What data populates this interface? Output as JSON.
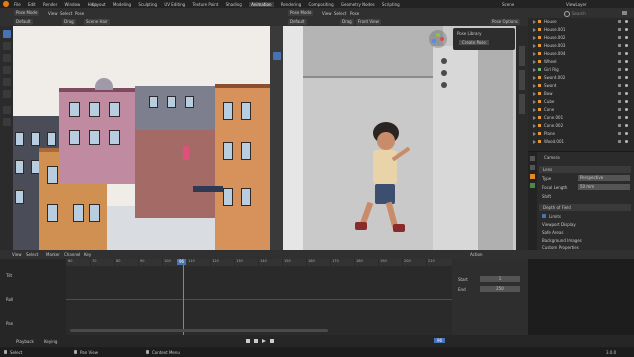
{
  "topbar": {
    "menus": [
      "File",
      "Edit",
      "Render",
      "Window",
      "Help"
    ],
    "workspaces": [
      "Layout",
      "Modeling",
      "Sculpting",
      "UV Editing",
      "Texture Paint",
      "Shading",
      "Animation",
      "Rendering",
      "Compositing",
      "Geometry Nodes",
      "Scripting"
    ],
    "active_workspace": "Animation",
    "scene_label": "Scene",
    "layer_label": "ViewLayer"
  },
  "left_viewport": {
    "mode": "Pose Mode",
    "orientation": "Default",
    "drag": "Drag",
    "snap": "Scene Hair",
    "menus": [
      "View",
      "Select",
      "Pose"
    ]
  },
  "right_viewport": {
    "mode": "Pose Mode",
    "view_menus": [
      "View",
      "Select",
      "Pose"
    ],
    "orientation": "Default",
    "drag": "Drag",
    "options_label": "Pose Options",
    "active_view": "Front View",
    "panel_title": "Pose Library",
    "panel_item": "Create Pose"
  },
  "outliner": {
    "search_placeholder": "Search",
    "items": [
      {
        "name": "House"
      },
      {
        "name": "House.001"
      },
      {
        "name": "House.002"
      },
      {
        "name": "House.003"
      },
      {
        "name": "House.004"
      },
      {
        "name": "Wheel"
      },
      {
        "name": "Girl Rig"
      },
      {
        "name": "Sword.002"
      },
      {
        "name": "Sword"
      },
      {
        "name": "Bow"
      },
      {
        "name": "Cube"
      },
      {
        "name": "Cone"
      },
      {
        "name": "Cone.001"
      },
      {
        "name": "Cone.002"
      },
      {
        "name": "Plane"
      },
      {
        "name": "Wood.001"
      }
    ]
  },
  "properties": {
    "object_name": "Camera",
    "section_lens": "Lens",
    "field_type_label": "Type",
    "field_type_value": "Perspective",
    "field_focal_label": "Focal Length",
    "field_focal_value": "50 mm",
    "field_shift": "Shift",
    "section_dof": "Depth of Field",
    "checkbox_label": "Limits",
    "section_viewport": "Viewport Display",
    "section_safe": "Safe Areas",
    "section_bg": "Background Images",
    "section_custom": "Custom Properties"
  },
  "timeline": {
    "menus": [
      "View",
      "Select",
      "Marker",
      "Channel",
      "Key"
    ],
    "playback_label": "Playback",
    "keying_label": "Keying",
    "current_frame": "96",
    "frame_ticks": [
      "60",
      "70",
      "80",
      "90",
      "100",
      "110",
      "120",
      "130",
      "140",
      "150",
      "160",
      "170",
      "180",
      "190",
      "200",
      "210"
    ],
    "side_panel_title": "Action",
    "row_labels": [
      "Tilt",
      "Roll",
      "Pan"
    ],
    "start_label": "Start",
    "start_value": "1",
    "end_label": "End",
    "end_value": "250"
  },
  "statusbar": {
    "left": "Select",
    "middle": "Pan View",
    "right": "Context Menu",
    "version": "3.0.0"
  },
  "colors": {
    "accent": "#4772b3",
    "playhead": "#5a8dd6",
    "panel_bg": "#303030",
    "viewport_bg": "#3d3d3d",
    "sky": "#f0ece8"
  }
}
